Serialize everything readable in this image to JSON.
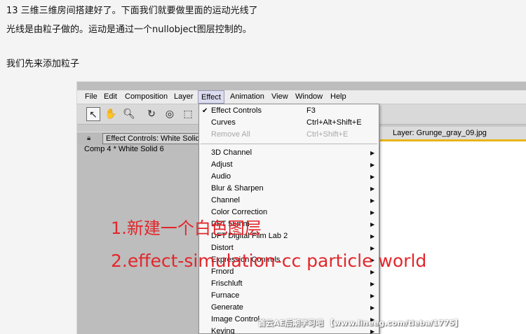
{
  "article": {
    "line1": "13 三维三维房间搭建好了。下面我们就要做里面的运动光线了",
    "line2": "光线是由粒子做的。运动是通过一个nullobject图层控制的。",
    "line3": "我们先来添加粒子"
  },
  "menubar": {
    "items": [
      "File",
      "Edit",
      "Composition",
      "Layer",
      "Effect",
      "Animation",
      "View",
      "Window",
      "Help"
    ],
    "active": "Effect"
  },
  "toolbar": {
    "tools": [
      "selection-tool-icon",
      "hand-tool-icon",
      "zoom-tool-icon",
      "rotate-tool-icon",
      "camera-orbit-icon",
      "pan-behind-icon"
    ]
  },
  "panels": {
    "effect_controls_tab": "Effect Controls: White Solid",
    "layer_tab": "Layer: Grunge_gray_09.jpg",
    "comp_label": "Comp 4 * White Solid 6"
  },
  "effect_menu": {
    "top_items": [
      {
        "label": "Effect Controls",
        "shortcut": "F3",
        "checked": true,
        "disabled": false
      },
      {
        "label": "Curves",
        "shortcut": "Ctrl+Alt+Shift+E",
        "checked": false,
        "disabled": false
      },
      {
        "label": "Remove All",
        "shortcut": "Ctrl+Shift+E",
        "checked": false,
        "disabled": true
      }
    ],
    "categories": [
      "3D Channel",
      "Adjust",
      "Audio",
      "Blur & Sharpen",
      "Channel",
      "Color Correction",
      "DFT 55mm",
      "DFT Digital Film Lab 2",
      "Distort",
      "Expression Controls",
      "Frnord",
      "Frischluft",
      "Furnace",
      "Generate",
      "Image Control",
      "Keying"
    ]
  },
  "annotations": {
    "step1": "1.新建一个白色图层",
    "step2": "2.effect-simulation-cc particle world"
  },
  "watermark": "首云AE后期学习吧 【www.lineeg.com/tieba/1775】",
  "colors": {
    "annotation": "#e3262b",
    "layer_tab_accent": "#e8b41a"
  }
}
